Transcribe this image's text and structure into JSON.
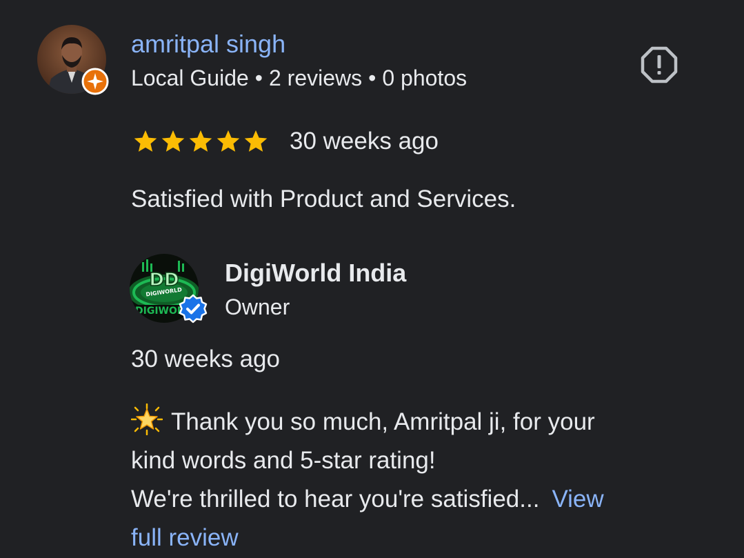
{
  "review": {
    "reviewer_name": "amritpal singh",
    "reviewer_badge": "Local Guide",
    "reviews_count": "2 reviews",
    "photos_count": "0 photos",
    "separator": "•",
    "rating": 5,
    "rating_max": 5,
    "date": "30 weeks ago",
    "text": "Satisfied with Product and Services.",
    "icons": {
      "report": "report-flag-icon",
      "star": "star-icon",
      "guide_badge": "local-guide-badge-icon"
    }
  },
  "reply": {
    "owner_name": "DigiWorld India",
    "owner_role": "Owner",
    "logo_text": "DIGIWORLD",
    "date": "30 weeks ago",
    "line1": "Thank you so much, Amritpal ji, for your",
    "line2": "kind words and 5-star rating!",
    "line3": "We're thrilled to hear you're satisfied...",
    "view_label_part1": "View",
    "view_label_part2": "full review",
    "icons": {
      "verified": "verified-badge-icon",
      "emoji": "glowing-star-emoji"
    }
  },
  "colors": {
    "background": "#202124",
    "link": "#8ab4f8",
    "text": "#e8eaed",
    "star": "#fbbc04",
    "guide_badge": "#e8710a",
    "verified": "#1a73e8",
    "logo_green": "#1db954"
  }
}
